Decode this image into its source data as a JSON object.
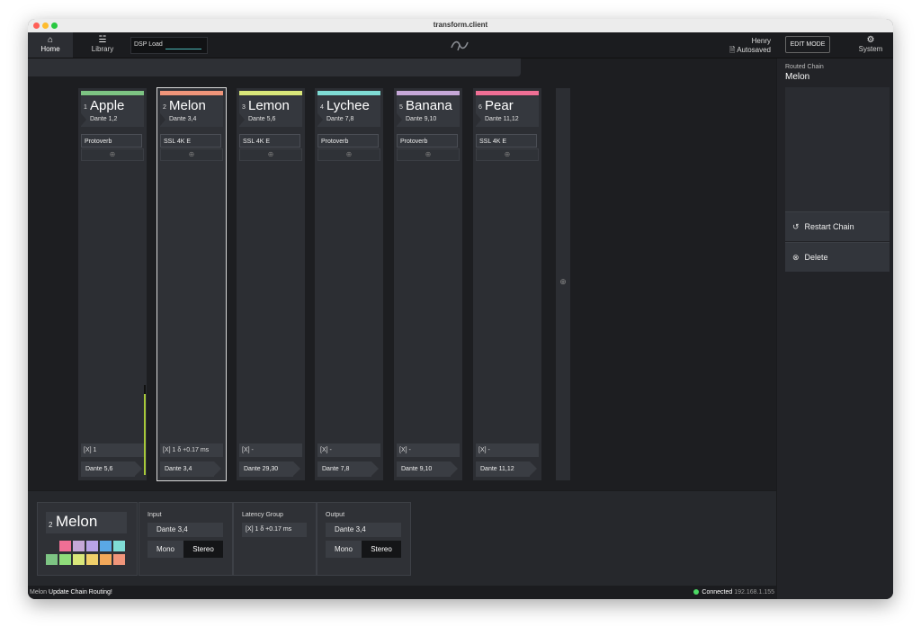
{
  "window": {
    "title": "transform.client"
  },
  "toolbar": {
    "home_label": "Home",
    "library_label": "Library",
    "dsp_label": "DSP Load",
    "user_name": "Henry",
    "autosave_label": "Autosaved",
    "edit_mode_label": "EDIT MODE",
    "system_label": "System"
  },
  "chains": [
    {
      "num": "1",
      "name": "Apple",
      "input": "Dante 1,2",
      "plugin": "Protoverb",
      "group": "[X] 1",
      "output": "Dante 5,6",
      "color": "#7dc483"
    },
    {
      "num": "2",
      "name": "Melon",
      "input": "Dante 3,4",
      "plugin": "SSL 4K E",
      "group": "[X] 1   δ +0.17 ms",
      "output": "Dante 3,4",
      "color": "#f0957a"
    },
    {
      "num": "3",
      "name": "Lemon",
      "input": "Dante 5,6",
      "plugin": "SSL 4K E",
      "group": "[X] -",
      "output": "Dante 29,30",
      "color": "#d9e77a"
    },
    {
      "num": "4",
      "name": "Lychee",
      "input": "Dante 7,8",
      "plugin": "Protoverb",
      "group": "[X] -",
      "output": "Dante 7,8",
      "color": "#7fdcd5"
    },
    {
      "num": "5",
      "name": "Banana",
      "input": "Dante 9,10",
      "plugin": "Protoverb",
      "group": "[X] -",
      "output": "Dante 9,10",
      "color": "#c6a8d8"
    },
    {
      "num": "6",
      "name": "Pear",
      "input": "Dante 11,12",
      "plugin": "SSL 4K E",
      "group": "[X] -",
      "output": "Dante 11,12",
      "color": "#ef6f95"
    }
  ],
  "detail": {
    "num": "2",
    "name": "Melon",
    "input_header": "Input",
    "input_value": "Dante 3,4",
    "latency_header": "Latency Group",
    "latency_value": "[X] 1   δ +0.17 ms",
    "output_header": "Output",
    "output_value": "Dante 3,4",
    "mono_label": "Mono",
    "stereo_label": "Stereo",
    "swatches": [
      "#ef6f95",
      "#c6a8d8",
      "#b8a3e6",
      "#5aa8e6",
      "#7fdcd5",
      "#7dc483",
      "#8fdc7a",
      "#d9e77a",
      "#f0cf6a",
      "#f2a85a",
      "#f0957a"
    ]
  },
  "side_panel": {
    "header": "Routed Chain",
    "chain_name": "Melon",
    "restart_label": "Restart Chain",
    "delete_label": "Delete"
  },
  "status": {
    "chain_name": "Melon",
    "message": "Update Chain Routing!",
    "connection": "Connected",
    "ip": "192.168.1.155"
  }
}
